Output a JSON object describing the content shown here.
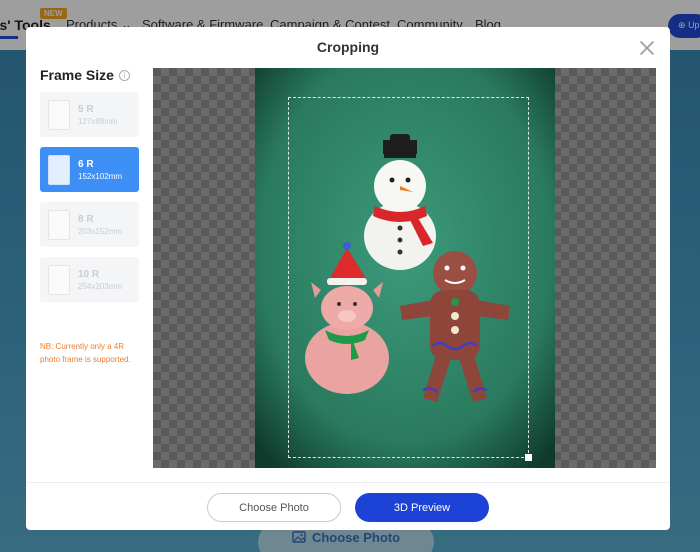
{
  "background": {
    "nav": {
      "tools_label": "rs' Tools",
      "new_badge": "NEW",
      "products_label": "Products",
      "software_label": "Software & Firmware",
      "campaign_label": "Campaign & Contest",
      "community_label": "Community",
      "blog_label": "Blog",
      "upload_label": "Up"
    },
    "choose_photo_label": "Choose Photo"
  },
  "modal": {
    "title": "Cropping",
    "sidebar": {
      "heading": "Frame Size",
      "sizes": [
        {
          "name": "5 R",
          "dims": "127x89mm"
        },
        {
          "name": "6 R",
          "dims": "152x102mm"
        },
        {
          "name": "8 R",
          "dims": "203x152mm"
        },
        {
          "name": "10 R",
          "dims": "254x203mm"
        }
      ],
      "selected": "6 R",
      "note": "NB: Currently only a 4R photo frame is supported."
    },
    "footer": {
      "choose_photo": "Choose Photo",
      "preview_3d": "3D Preview"
    }
  },
  "colors": {
    "accent": "#1d43d6",
    "selected_option": "#3d8ff5",
    "note": "#f07c2e",
    "photo_background": "#2f8a6c"
  }
}
